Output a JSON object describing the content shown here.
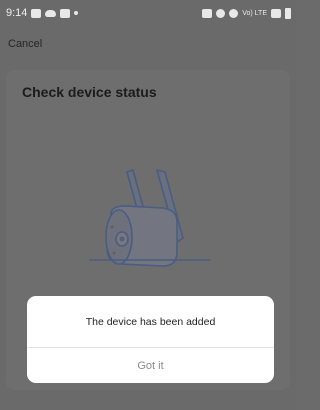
{
  "status_bar": {
    "time": "9:14",
    "signal_label": "Vo) LTE"
  },
  "header": {
    "cancel_label": "Cancel"
  },
  "main": {
    "title": "Check device status",
    "illustration": "security-camera-icon"
  },
  "dialog": {
    "message": "The device has been added",
    "button_label": "Got it"
  },
  "colors": {
    "overlay": "#6a6a6a",
    "dialog_bg": "#ffffff",
    "button_text": "#8a8a8a"
  }
}
